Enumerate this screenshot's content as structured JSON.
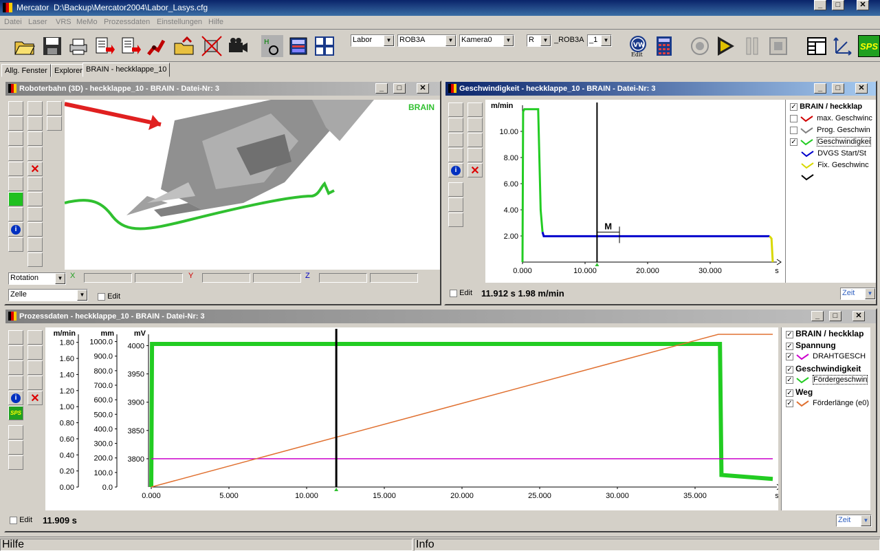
{
  "app": {
    "title": "Mercator  D:\\Backup\\Mercator2004\\Labor_Lasys.cfg"
  },
  "menu": [
    "Datei",
    "Laser",
    "VRS",
    "MeMo",
    "Prozessdaten",
    "Einstellungen",
    "Hilfe"
  ],
  "toolbar": {
    "combo_labor": "Labor",
    "combo_robot": "ROB3A",
    "combo_camera": "Kamera0",
    "combo_r": "R",
    "robot_label": "_ROB3A",
    "combo_num": "_1",
    "edit_label": "Edit",
    "sps_label": "SPS"
  },
  "tabs": [
    "Allg. Fenster",
    "Explorer",
    "BRAIN - heckklappe_10"
  ],
  "win3d": {
    "title": "Roboterbahn (3D)  - heckklappe_10 - BRAIN - Datei-Nr: 3",
    "badge": "BRAIN",
    "axis_x": "X",
    "axis_y": "Y",
    "axis_z": "Z",
    "combo_mode": "Rotation",
    "combo_cell": "Zelle",
    "edit_label": "Edit"
  },
  "winspeed": {
    "title": "Geschwindigkeit - heckklappe_10 - BRAIN - Datei-Nr: 3",
    "status": "11.912 s 1.98 m/min",
    "edit_label": "Edit",
    "zeit_combo": "Zeit",
    "marker_label": "M",
    "legend": [
      {
        "checked": true,
        "label": "BRAIN / heckklap",
        "bold": true,
        "color": ""
      },
      {
        "checked": false,
        "label": "max. Geschwinc",
        "color": "#d00000"
      },
      {
        "checked": false,
        "label": "Prog. Geschwin",
        "color": "#808080"
      },
      {
        "checked": true,
        "label": "Geschwindigkei",
        "color": "#22cc22"
      },
      {
        "checked": null,
        "label": "DVGS Start/St",
        "color": "#0000cc"
      },
      {
        "checked": null,
        "label": "Fix. Geschwinc",
        "color": "#d8d800"
      },
      {
        "checked": null,
        "label": "",
        "color": "#000000"
      }
    ]
  },
  "winproc": {
    "title": "Prozessdaten - heckklappe_10 - BRAIN - Datei-Nr: 3",
    "status": "11.909 s",
    "edit_label": "Edit",
    "zeit_combo": "Zeit",
    "legend": [
      {
        "label": "BRAIN / heckklap",
        "bold": true,
        "color": ""
      },
      {
        "label": "Spannung",
        "bold": true,
        "color": ""
      },
      {
        "label": "DRAHTGESCH",
        "bold": false,
        "color": "#cc00cc"
      },
      {
        "label": "Geschwindigkeit",
        "bold": true,
        "color": ""
      },
      {
        "label": "Fördergeschwin",
        "bold": false,
        "color": "#22cc22"
      },
      {
        "label": "Weg",
        "bold": true,
        "color": ""
      },
      {
        "label": "Förderlänge (e0)",
        "bold": false,
        "color": "#e07030"
      }
    ]
  },
  "chart_data": [
    {
      "type": "line",
      "x_unit": "s",
      "y_unit": "m/min",
      "xlim": [
        0,
        40
      ],
      "ylim": [
        0,
        12
      ],
      "x_ticks": [
        "0.000",
        "10.000",
        "20.000",
        "30.000"
      ],
      "y_ticks": [
        "2.00",
        "4.00",
        "6.00",
        "8.00",
        "10.00"
      ],
      "cursor_x": 11.912,
      "series": [
        {
          "name": "Geschwindigkeit",
          "color": "#22cc22",
          "x": [
            0,
            0.1,
            0.3,
            2.5,
            2.9,
            3.2
          ],
          "y": [
            0,
            11.5,
            11.7,
            11.7,
            4,
            2.3
          ]
        },
        {
          "name": "DVGS Start/St",
          "color": "#0000cc",
          "x": [
            3.2,
            3.4,
            39.5
          ],
          "y": [
            2.3,
            1.98,
            1.98
          ]
        },
        {
          "name": "Fix. Geschwinc",
          "color": "#d8d800",
          "x": [
            39.5,
            39.8,
            40
          ],
          "y": [
            1.98,
            1.8,
            0
          ]
        }
      ]
    },
    {
      "type": "line",
      "x_unit": "s",
      "xlim": [
        0,
        40
      ],
      "x_ticks": [
        "0.000",
        "5.000",
        "10.000",
        "15.000",
        "20.000",
        "25.000",
        "30.000",
        "35.000"
      ],
      "axes": [
        {
          "unit": "m/min",
          "ylim": [
            0,
            1.9
          ],
          "ticks": [
            "0.00",
            "0.20",
            "0.40",
            "0.60",
            "0.80",
            "1.00",
            "1.20",
            "1.40",
            "1.60",
            "1.80"
          ]
        },
        {
          "unit": "mm",
          "ylim": [
            0,
            1050
          ],
          "ticks": [
            "0.0",
            "100.0",
            "200.0",
            "300.0",
            "400.0",
            "500.0",
            "600.0",
            "700.0",
            "800.0",
            "900.0",
            "1000.0"
          ]
        },
        {
          "unit": "mV",
          "ylim": [
            3750,
            4020
          ],
          "ticks": [
            "3800",
            "3850",
            "3900",
            "3950",
            "4000"
          ]
        }
      ],
      "cursor_x": 11.909,
      "series": [
        {
          "name": "Fördergeschwin",
          "color": "#22cc22",
          "axis": "m/min",
          "x": [
            0,
            0.05,
            36.6,
            36.7,
            40
          ],
          "y": [
            0,
            1.78,
            1.78,
            0.15,
            0.1
          ]
        },
        {
          "name": "DRAHTGESCH",
          "color": "#cc00cc",
          "axis": "mV",
          "x": [
            0,
            40
          ],
          "y": [
            3800,
            3800
          ]
        },
        {
          "name": "Förderlänge (e0)",
          "color": "#e07030",
          "axis": "mm",
          "x": [
            0,
            36.5,
            40
          ],
          "y": [
            0,
            1050,
            1050
          ]
        }
      ]
    }
  ]
}
